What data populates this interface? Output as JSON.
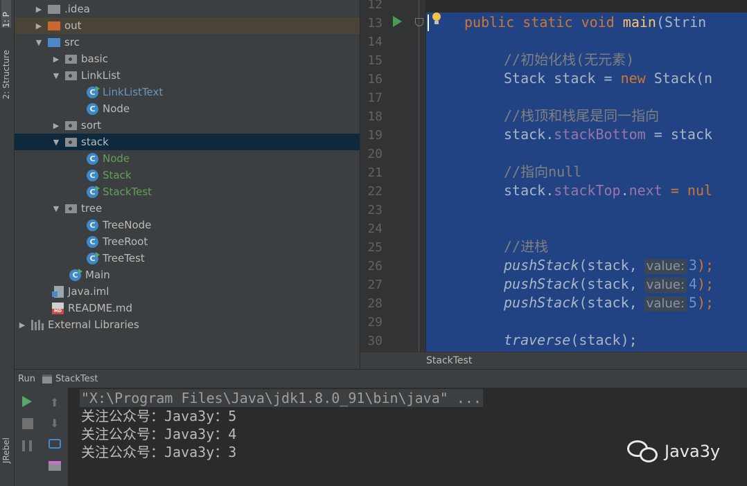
{
  "toolwindows": {
    "project_tab": "1: P",
    "structure_tab": "2: Structure",
    "jrebel_tab": "JRebel"
  },
  "tree": {
    "items": [
      {
        "label": ".idea"
      },
      {
        "label": "out"
      },
      {
        "label": "src"
      },
      {
        "label": "basic"
      },
      {
        "label": "LinkList"
      },
      {
        "label": "LinkListText"
      },
      {
        "label": "Node"
      },
      {
        "label": "sort"
      },
      {
        "label": "stack"
      },
      {
        "label": "Node"
      },
      {
        "label": "Stack"
      },
      {
        "label": "StackTest"
      },
      {
        "label": "tree"
      },
      {
        "label": "TreeNode"
      },
      {
        "label": "TreeRoot"
      },
      {
        "label": "TreeTest"
      },
      {
        "label": "Main"
      },
      {
        "label": "Java.iml"
      },
      {
        "label": "README.md"
      },
      {
        "label": "External Libraries"
      }
    ]
  },
  "editor": {
    "line_numbers": [
      "12",
      "13",
      "14",
      "15",
      "16",
      "17",
      "18",
      "19",
      "20",
      "21",
      "22",
      "23",
      "24",
      "25",
      "26",
      "27",
      "28",
      "29",
      "30"
    ],
    "code": {
      "l13_kw": "public static void ",
      "l13_fn": "main",
      "l13_rest": "(Strin",
      "l15": "//初始化栈(无元素)",
      "l16_a": "Stack stack = ",
      "l16_kw": "new",
      "l16_b": " Stack(n",
      "l18": "//栈顶和栈尾是同一指向",
      "l19_a": "stack.",
      "l19_f": "stackBottom",
      "l19_b": " = stack",
      "l21": "//指向null",
      "l22_a": "stack.",
      "l22_f1": "stackTop",
      "l22_dot": ".",
      "l22_f2": "next",
      "l22_b": " = nul",
      "l25": "//进栈",
      "push_fn": "pushStack",
      "push_arg": "(stack,",
      "hint": "value:",
      "v1": "3",
      "v2": "4",
      "v3": "5",
      "push_end": ");",
      "l30_fn": "traverse",
      "l30_rest": "(stack);"
    },
    "breadcrumb": "StackTest"
  },
  "run": {
    "label": "Run",
    "tab": "StackTest",
    "console_lines": [
      "\"X:\\Program Files\\Java\\jdk1.8.0_91\\bin\\java\" ...",
      "关注公众号：Java3y：5",
      "关注公众号：Java3y：4",
      "关注公众号：Java3y：3"
    ]
  },
  "watermark": {
    "text": "Java3y"
  }
}
